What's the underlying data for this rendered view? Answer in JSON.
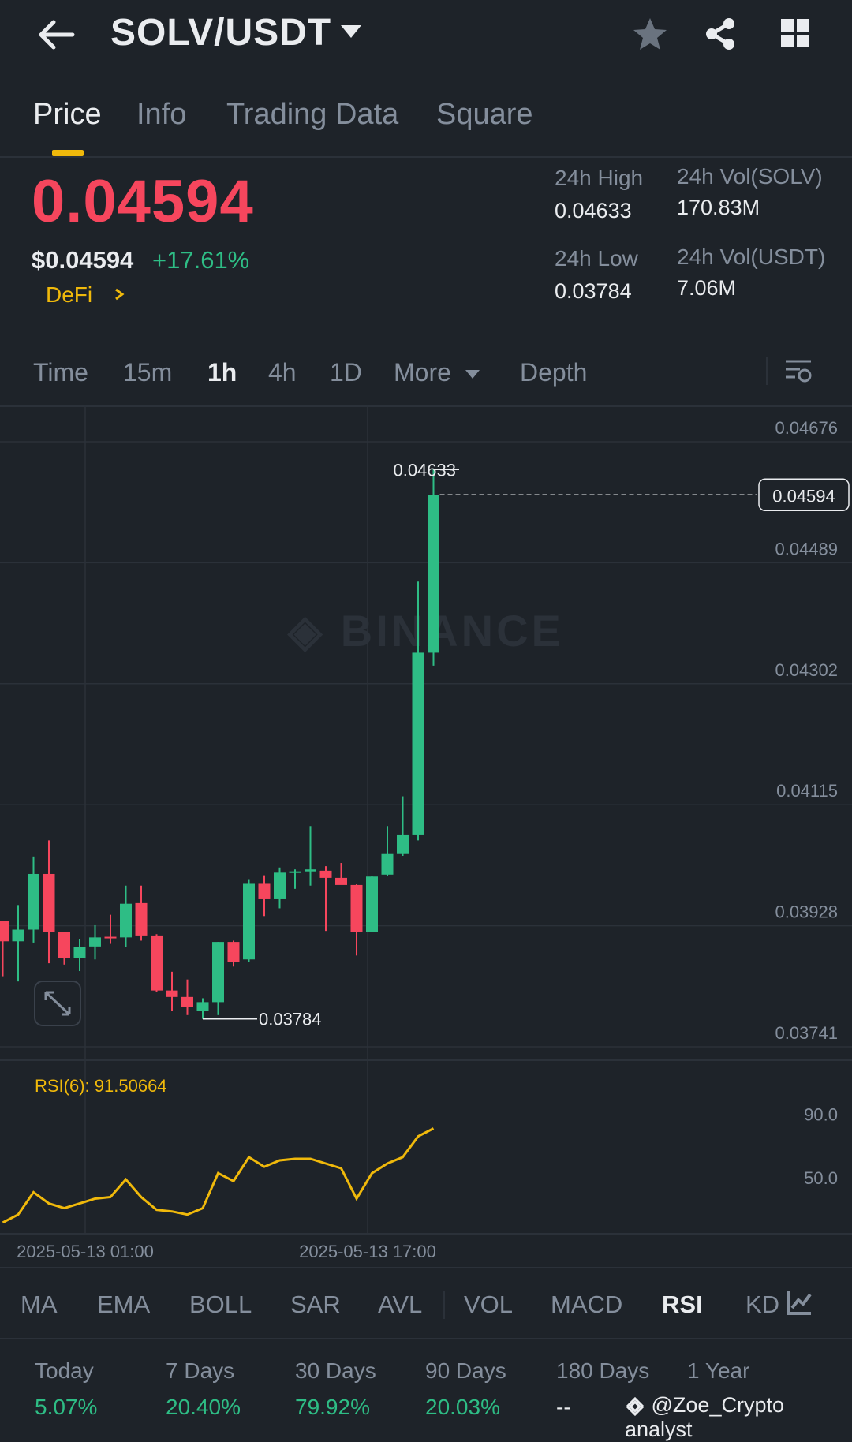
{
  "header": {
    "pair": "SOLV/USDT",
    "icons": [
      "back-arrow-icon",
      "dropdown-caret-icon",
      "star-icon",
      "share-icon",
      "grid-icon"
    ]
  },
  "tabs": [
    {
      "label": "Price",
      "active": true
    },
    {
      "label": "Info",
      "active": false
    },
    {
      "label": "Trading Data",
      "active": false
    },
    {
      "label": "Square",
      "active": false
    }
  ],
  "price": {
    "last": "0.04594",
    "usd": "$0.04594",
    "change": "+17.61%",
    "category": "DeFi"
  },
  "stats": {
    "high_label": "24h High",
    "high": "0.04633",
    "low_label": "24h Low",
    "low": "0.03784",
    "vol_base_label": "24h Vol(SOLV)",
    "vol_base": "170.83M",
    "vol_quote_label": "24h Vol(USDT)",
    "vol_quote": "7.06M"
  },
  "intervals": [
    "Time",
    "15m",
    "1h",
    "4h",
    "1D",
    "More",
    "Depth"
  ],
  "active_interval": "1h",
  "colors": {
    "up": "#2ebd85",
    "down": "#f6465d",
    "accent": "#f0b90b",
    "bg": "#1e2329"
  },
  "chart_data": {
    "type": "candlestick",
    "interval": "1h",
    "y_ticks": [
      "0.04676",
      "0.04489",
      "0.04302",
      "0.04115",
      "0.03928",
      "0.03741"
    ],
    "ylim": [
      0.03741,
      0.04676
    ],
    "x_ticks": [
      "2025-05-13 01:00",
      "2025-05-13 17:00"
    ],
    "current_price_label": "0.04594",
    "high_marker": "0.04633",
    "low_marker": "0.03784",
    "watermark": "BINANCE",
    "candles": [
      {
        "o": 0.03936,
        "h": 0.03936,
        "l": 0.0385,
        "c": 0.03904
      },
      {
        "o": 0.03904,
        "h": 0.0396,
        "l": 0.03842,
        "c": 0.03922
      },
      {
        "o": 0.03922,
        "h": 0.04035,
        "l": 0.03902,
        "c": 0.04008
      },
      {
        "o": 0.04008,
        "h": 0.0406,
        "l": 0.0387,
        "c": 0.03918
      },
      {
        "o": 0.03918,
        "h": 0.03918,
        "l": 0.03868,
        "c": 0.03878
      },
      {
        "o": 0.03878,
        "h": 0.03908,
        "l": 0.03858,
        "c": 0.03895
      },
      {
        "o": 0.03896,
        "h": 0.0393,
        "l": 0.03876,
        "c": 0.0391
      },
      {
        "o": 0.03911,
        "h": 0.03945,
        "l": 0.039,
        "c": 0.0391
      },
      {
        "o": 0.0391,
        "h": 0.0399,
        "l": 0.03895,
        "c": 0.03962
      },
      {
        "o": 0.03963,
        "h": 0.0399,
        "l": 0.03905,
        "c": 0.03913
      },
      {
        "o": 0.03913,
        "h": 0.03915,
        "l": 0.03826,
        "c": 0.03828
      },
      {
        "o": 0.03828,
        "h": 0.03857,
        "l": 0.03797,
        "c": 0.03818
      },
      {
        "o": 0.03818,
        "h": 0.03845,
        "l": 0.0379,
        "c": 0.03803
      },
      {
        "o": 0.03796,
        "h": 0.03816,
        "l": 0.03784,
        "c": 0.0381
      },
      {
        "o": 0.0381,
        "h": 0.03903,
        "l": 0.0379,
        "c": 0.03903
      },
      {
        "o": 0.03903,
        "h": 0.03905,
        "l": 0.03865,
        "c": 0.03872
      },
      {
        "o": 0.03876,
        "h": 0.04,
        "l": 0.03872,
        "c": 0.03994
      },
      {
        "o": 0.03994,
        "h": 0.04006,
        "l": 0.03943,
        "c": 0.03969
      },
      {
        "o": 0.03969,
        "h": 0.04018,
        "l": 0.03955,
        "c": 0.0401
      },
      {
        "o": 0.0401,
        "h": 0.04015,
        "l": 0.03985,
        "c": 0.04012
      },
      {
        "o": 0.04012,
        "h": 0.04082,
        "l": 0.0399,
        "c": 0.04015
      },
      {
        "o": 0.04013,
        "h": 0.0402,
        "l": 0.0392,
        "c": 0.04002
      },
      {
        "o": 0.04002,
        "h": 0.04025,
        "l": 0.03995,
        "c": 0.03991
      },
      {
        "o": 0.03991,
        "h": 0.03992,
        "l": 0.03882,
        "c": 0.03918
      },
      {
        "o": 0.03918,
        "h": 0.04005,
        "l": 0.03918,
        "c": 0.04004
      },
      {
        "o": 0.04007,
        "h": 0.04082,
        "l": 0.04005,
        "c": 0.0404
      },
      {
        "o": 0.0404,
        "h": 0.04128,
        "l": 0.04036,
        "c": 0.04069
      },
      {
        "o": 0.04069,
        "h": 0.0446,
        "l": 0.0406,
        "c": 0.0435
      },
      {
        "o": 0.0435,
        "h": 0.04633,
        "l": 0.0433,
        "c": 0.04594
      }
    ],
    "rsi": {
      "label": "RSI(6): 91.50664",
      "y_ticks": [
        "90.0",
        "50.0"
      ],
      "ylim": [
        15,
        105
      ],
      "values": [
        22,
        27,
        41,
        34,
        31,
        34,
        37,
        38,
        49,
        38,
        30,
        29,
        27,
        31,
        53,
        48,
        63,
        57,
        61,
        62,
        62,
        59,
        56,
        37,
        53,
        59,
        63,
        76,
        81
      ]
    }
  },
  "indicators": [
    "MA",
    "EMA",
    "BOLL",
    "SAR",
    "AVL",
    "VOL",
    "MACD",
    "RSI",
    "KD"
  ],
  "active_indicator": "RSI",
  "performance": [
    {
      "label": "Today",
      "value": "5.07%"
    },
    {
      "label": "7 Days",
      "value": "20.40%"
    },
    {
      "label": "30 Days",
      "value": "79.92%"
    },
    {
      "label": "90 Days",
      "value": "20.03%"
    },
    {
      "label": "180 Days",
      "value": "--"
    },
    {
      "label": "1 Year",
      "value": ""
    }
  ],
  "author": "@Zoe_Crypto analyst"
}
